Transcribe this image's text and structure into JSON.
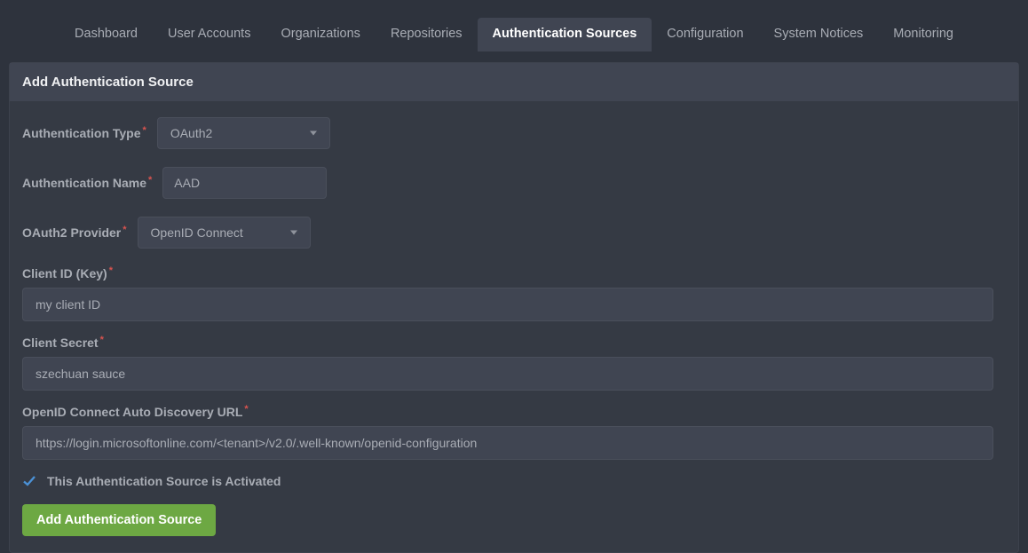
{
  "nav": {
    "tabs": [
      {
        "label": "Dashboard"
      },
      {
        "label": "User Accounts"
      },
      {
        "label": "Organizations"
      },
      {
        "label": "Repositories"
      },
      {
        "label": "Authentication Sources"
      },
      {
        "label": "Configuration"
      },
      {
        "label": "System Notices"
      },
      {
        "label": "Monitoring"
      }
    ],
    "active_index": 4
  },
  "panel": {
    "title": "Add Authentication Source"
  },
  "form": {
    "auth_type_label": "Authentication Type",
    "auth_type_value": "OAuth2",
    "auth_name_label": "Authentication Name",
    "auth_name_value": "AAD",
    "oauth2_provider_label": "OAuth2 Provider",
    "oauth2_provider_value": "OpenID Connect",
    "client_id_label": "Client ID (Key)",
    "client_id_value": "my client ID",
    "client_secret_label": "Client Secret",
    "client_secret_value": "szechuan sauce",
    "discovery_url_label": "OpenID Connect Auto Discovery URL",
    "discovery_url_value": "https://login.microsoftonline.com/<tenant>/v2.0/.well-known/openid-configuration",
    "activated_label": "This Authentication Source is Activated",
    "activated_checked": true,
    "submit_label": "Add Authentication Source"
  }
}
